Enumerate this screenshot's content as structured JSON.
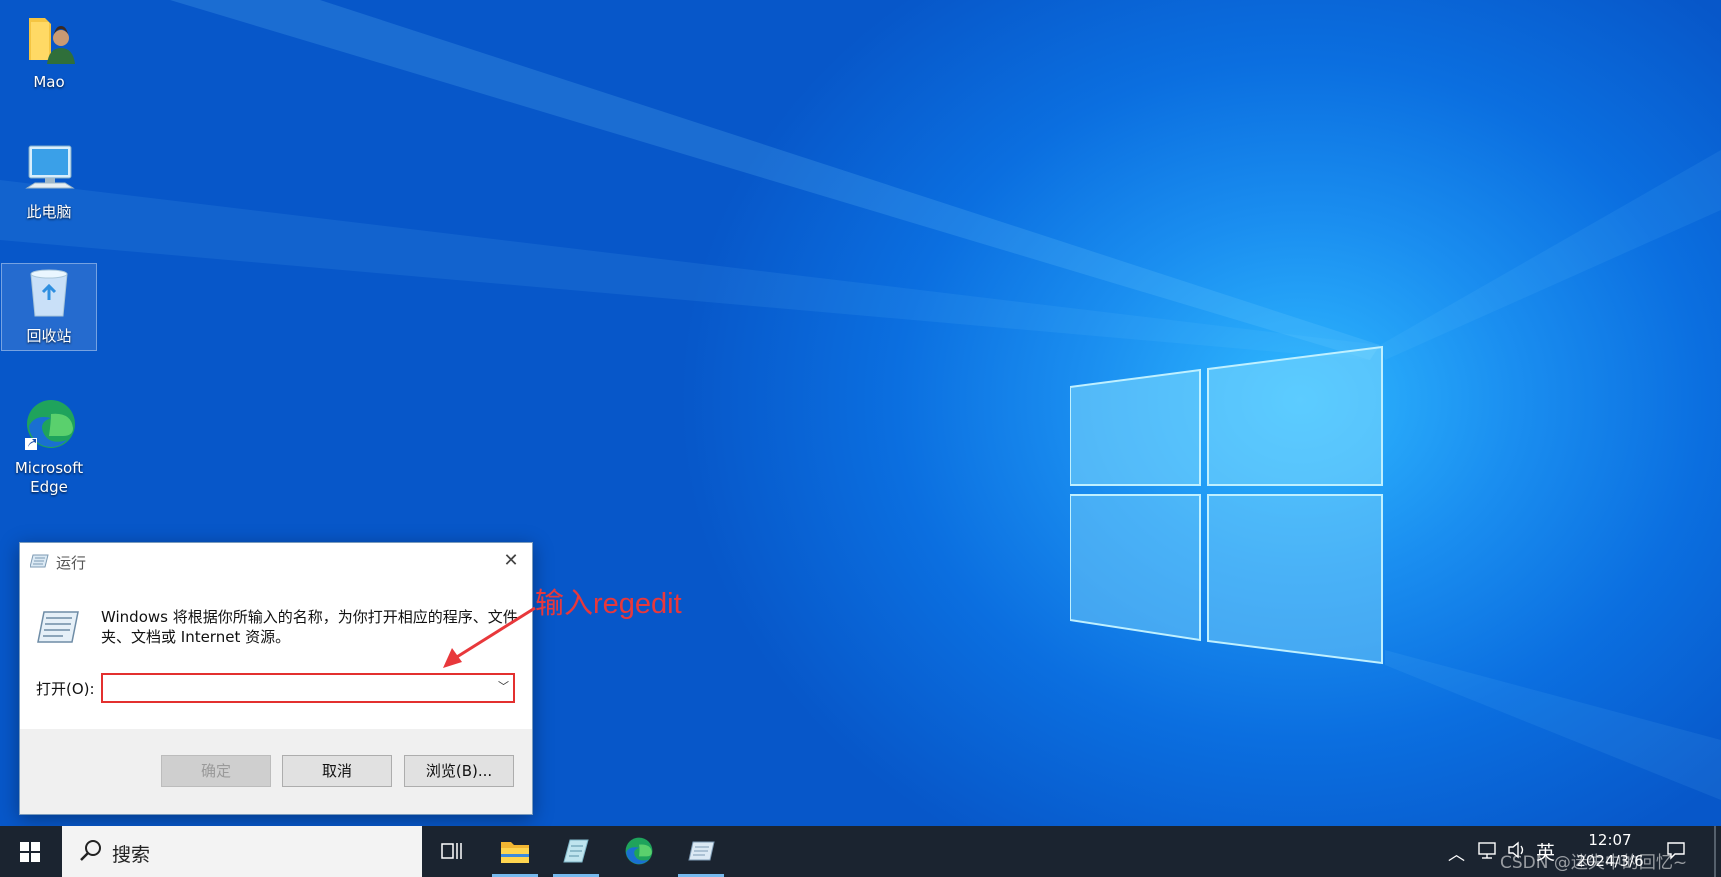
{
  "desktop": {
    "icons": [
      {
        "label": "Mao",
        "icon": "user-folder-icon"
      },
      {
        "label": "此电脑",
        "icon": "computer-icon"
      },
      {
        "label": "回收站",
        "icon": "recycle-bin-icon"
      },
      {
        "label": "Microsoft Edge",
        "icon": "edge-icon"
      }
    ]
  },
  "run_dialog": {
    "title": "运行",
    "description": "Windows 将根据你所输入的名称，为你打开相应的程序、文件夹、文档或 Internet 资源。",
    "open_label": "打开(O):",
    "open_value": "",
    "buttons": {
      "ok": "确定",
      "cancel": "取消",
      "browse": "浏览(B)..."
    }
  },
  "annotation": {
    "text": "输入regedit",
    "color": "#e8383b"
  },
  "taskbar": {
    "search_placeholder": "搜索",
    "apps": [
      "task-view-icon",
      "file-explorer-icon",
      "notepad-icon",
      "edge-icon",
      "run-icon"
    ],
    "tray": {
      "ime": "英",
      "time": "12:07",
      "date": "2024/3/6"
    }
  },
  "watermark": "CSDN @迷失中的回忆~",
  "colors": {
    "accent": "#0b6fe0",
    "taskbar": "#1b2430",
    "highlight": "#e3302f"
  }
}
